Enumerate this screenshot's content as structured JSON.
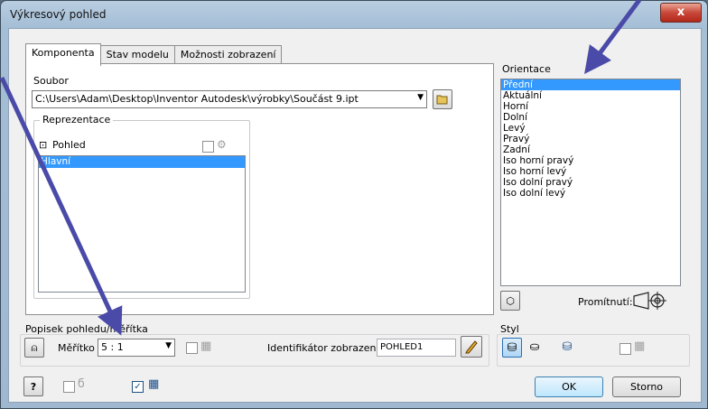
{
  "window": {
    "title": "Výkresový pohled",
    "close_label": "x"
  },
  "tabs": [
    {
      "label": "Komponenta"
    },
    {
      "label": "Stav modelu"
    },
    {
      "label": "Možnosti zobrazení"
    }
  ],
  "component": {
    "file_label": "Soubor",
    "file_path": "C:\\Users\\Adam\\Desktop\\Inventor Autodesk\\výrobky\\Součást 9.ipt",
    "representation_title": "Reprezentace",
    "view_label": "Pohled",
    "representation_items": [
      "Hlavní"
    ]
  },
  "orientation": {
    "title": "Orientace",
    "items": [
      "Přední",
      "Aktuální",
      "Horní",
      "Dolní",
      "Levý",
      "Pravý",
      "Zadní",
      "Iso horní pravý",
      "Iso horní levý",
      "Iso dolní pravý",
      "Iso dolní levý"
    ],
    "selected": "Přední",
    "projection_label": "Promítnutí:"
  },
  "caption": {
    "title": "Popisek pohledu/měřítka",
    "scale_label": "Měřítko",
    "scale_value": "5 : 1",
    "identifier_label": "Identifikátor zobrazení",
    "identifier_value": "POHLED1"
  },
  "style": {
    "title": "Styl"
  },
  "buttons": {
    "ok": "OK",
    "cancel": "Storno"
  },
  "colors": {
    "selection": "#3399ff",
    "annotation_arrow": "#4a4aa8"
  }
}
